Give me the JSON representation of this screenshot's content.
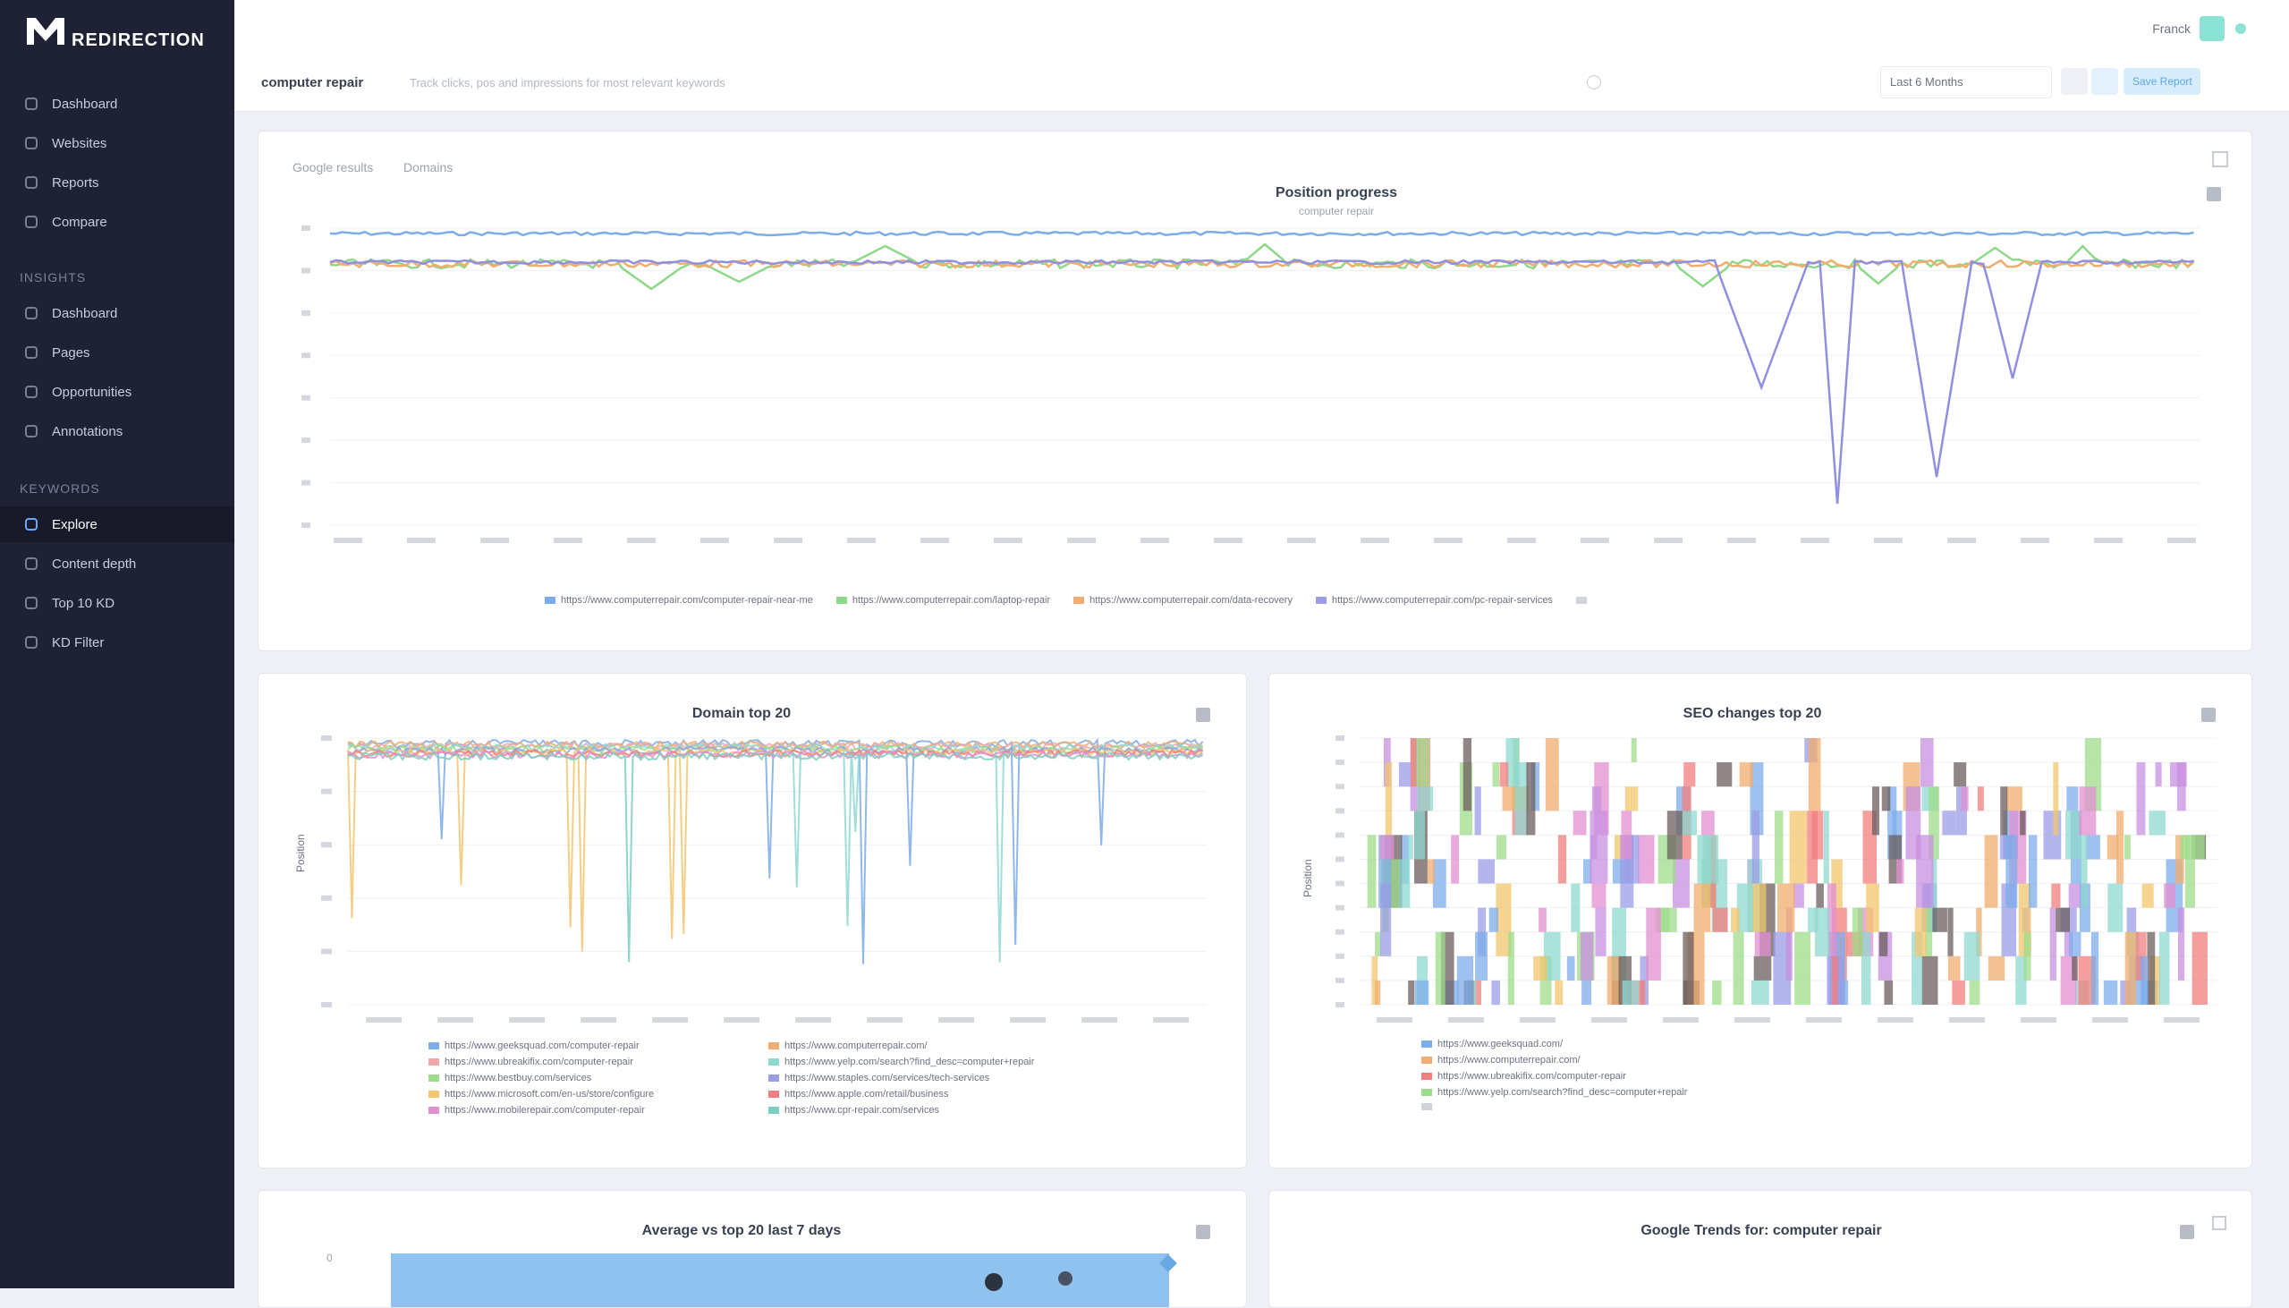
{
  "app": {
    "logo_small": "",
    "logo_big": "REDIRECTION"
  },
  "sidebar": {
    "sections": [
      {
        "label": ""
      },
      {
        "label": "INSIGHTS"
      },
      {
        "label": "KEYWORDS"
      }
    ],
    "items": [
      {
        "label": "Dashboard",
        "icon": "home-icon"
      },
      {
        "label": "Websites",
        "icon": "globe-icon"
      },
      {
        "label": "Reports",
        "icon": "file-icon"
      },
      {
        "label": "Compare",
        "icon": "compare-icon"
      },
      {
        "label": "Dashboard",
        "icon": "chart-icon"
      },
      {
        "label": "Pages",
        "icon": "page-icon"
      },
      {
        "label": "Opportunities",
        "icon": "target-icon"
      },
      {
        "label": "Annotations",
        "icon": "note-icon"
      },
      {
        "label": "Explore",
        "icon": "explore-icon",
        "active": true
      },
      {
        "label": "Content depth",
        "icon": "depth-icon"
      },
      {
        "label": "Top 10 KD",
        "icon": "list-icon"
      },
      {
        "label": "KD Filter",
        "icon": "filter-icon"
      }
    ]
  },
  "topbar": {
    "user": "Franck",
    "project_label": "computer repair",
    "project_desc": "Track clicks, pos and impressions for most relevant keywords",
    "date_range": "Last 6 Months",
    "action_label": "Save Report"
  },
  "panel1": {
    "tabs": [
      "Google results",
      "Domains"
    ],
    "title": "Position progress",
    "subtitle": "computer repair",
    "legend": [
      {
        "label": "https://www.computerrepair.com/computer-repair-near-me",
        "color": "#7dacea"
      },
      {
        "label": "https://www.computerrepair.com/laptop-repair",
        "color": "#8fd889"
      },
      {
        "label": "https://www.computerrepair.com/data-recovery",
        "color": "#f0ad6e"
      },
      {
        "label": "https://www.computerrepair.com/pc-repair-services",
        "color": "#9a9ce6"
      },
      {
        "label": "",
        "color": "#cfd3db"
      }
    ],
    "footer": "",
    "colors": {
      "blue": "#7dacea",
      "green": "#8fd889",
      "orange": "#f0ad6e",
      "purple": "#8f90e0"
    }
  },
  "panel2": {
    "title": "Domain top 20",
    "ylabel": "Position",
    "legend": [
      {
        "label": "https://www.geeksquad.com/computer-repair",
        "color": "#7dacea"
      },
      {
        "label": "https://www.computerrepair.com/",
        "color": "#f0ad6e"
      },
      {
        "label": "https://www.ubreakifix.com/computer-repair",
        "color": "#f2a8a8"
      },
      {
        "label": "https://www.yelp.com/search?find_desc=computer+repair",
        "color": "#8fd8d0"
      },
      {
        "label": "https://www.bestbuy.com/services",
        "color": "#9ddc8a"
      },
      {
        "label": "https://www.staples.com/services/tech-services",
        "color": "#9a9ce6"
      },
      {
        "label": "https://www.microsoft.com/en-us/store/configure",
        "color": "#f2c66e"
      },
      {
        "label": "https://www.apple.com/retail/business",
        "color": "#f27e7e"
      },
      {
        "label": "https://www.mobilerepair.com/computer-repair",
        "color": "#e28fd0"
      },
      {
        "label": "https://www.cpr-repair.com/services",
        "color": "#79cfc0"
      }
    ],
    "footer": ""
  },
  "panel3": {
    "title": "SEO changes top 20",
    "ylabel": "Position",
    "legend": [
      {
        "label": "https://www.geeksquad.com/",
        "color": "#7dacea"
      },
      {
        "label": "https://www.computerrepair.com/",
        "color": "#f0ad6e"
      },
      {
        "label": "https://www.ubreakifix.com/computer-repair",
        "color": "#f27e7e"
      },
      {
        "label": "https://www.yelp.com/search?find_desc=computer+repair",
        "color": "#9ddc8a"
      },
      {
        "label": "",
        "color": "#cfd3db"
      }
    ],
    "footer": ""
  },
  "panel4": {
    "title": "Average vs top 20 last 7 days"
  },
  "panel5": {
    "title": "Google Trends for: computer repair"
  }
}
